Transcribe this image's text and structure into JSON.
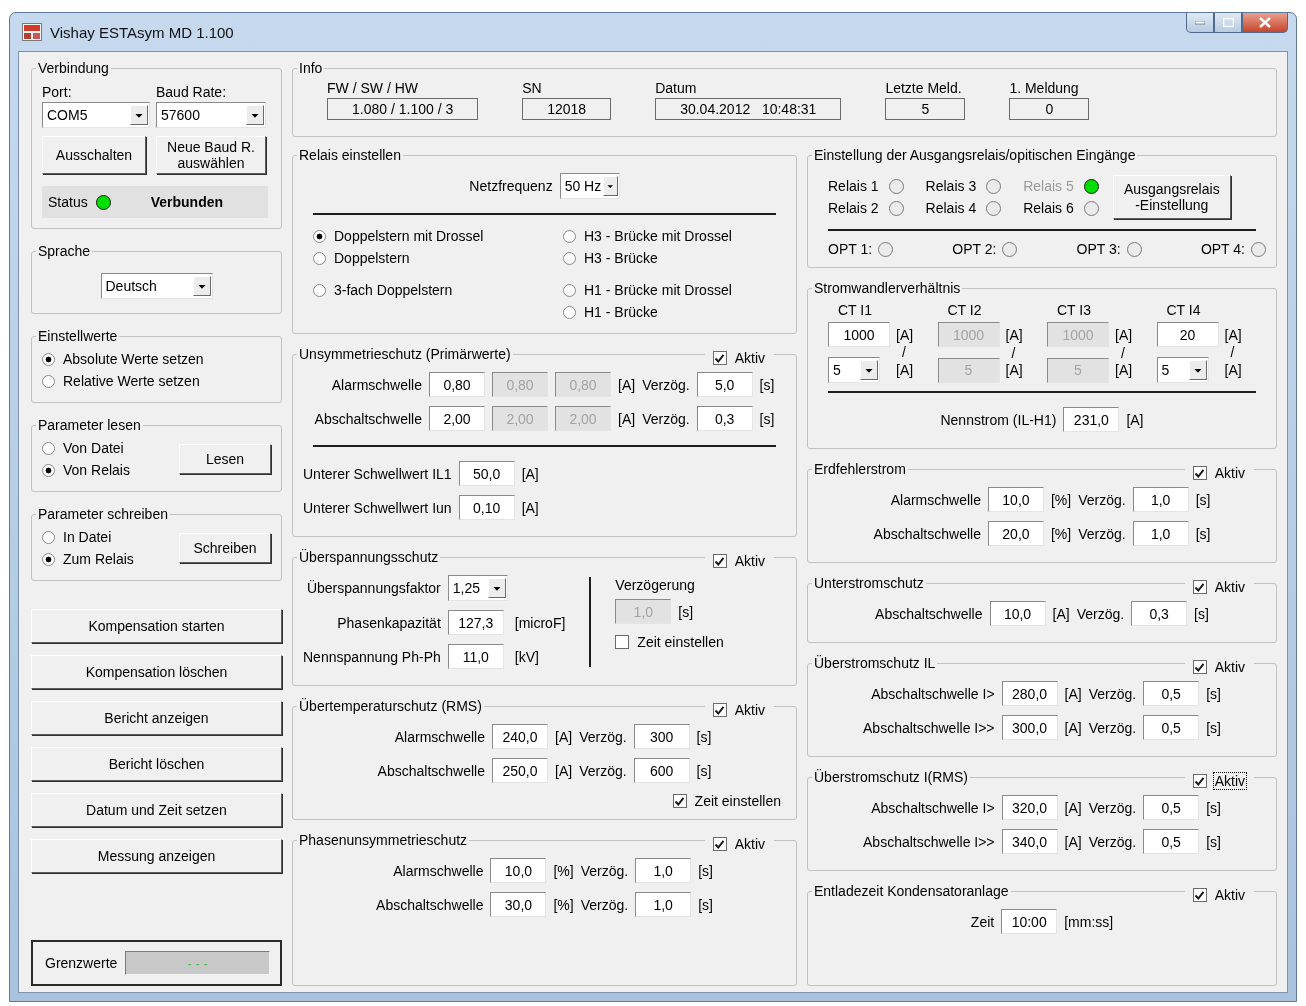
{
  "window": {
    "title": "Vishay ESTAsym MD 1.100"
  },
  "connection": {
    "title": "Verbindung",
    "port": {
      "label": "Port:",
      "value": "COM5"
    },
    "baud": {
      "label": "Baud Rate:",
      "value": "57600"
    },
    "buttons": [
      "Ausschalten",
      "Neue Baud R. auswählen"
    ],
    "status": {
      "label": "Status",
      "on": true,
      "text": "Verbunden"
    }
  },
  "language": {
    "title": "Sprache",
    "value": "Deutsch"
  },
  "radio_groups": [
    {
      "title": "Einstellwerte",
      "options": [
        {
          "label": "Absolute Werte setzen",
          "selected": true
        },
        {
          "label": "Relative Werte setzen",
          "selected": false
        }
      ]
    },
    {
      "title": "Parameter lesen",
      "options": [
        {
          "label": "Von Datei",
          "selected": false
        },
        {
          "label": "Von Relais",
          "selected": true
        }
      ],
      "button": "Lesen"
    },
    {
      "title": "Parameter schreiben",
      "options": [
        {
          "label": "In Datei",
          "selected": false
        },
        {
          "label": "Zum Relais",
          "selected": true
        }
      ],
      "button": "Schreiben"
    }
  ],
  "actions": [
    "Kompensation starten",
    "Kompensation löschen",
    "Bericht anzeigen",
    "Bericht löschen",
    "Datum und Zeit setzen",
    "Messung anzeigen"
  ],
  "limits": {
    "label": "Grenzwerte",
    "value": "- - -"
  },
  "info": {
    "title": "Info",
    "fields": [
      {
        "label": "FW / SW / HW",
        "value": "1.080 / 1.100 / 3"
      },
      {
        "label": "SN",
        "value": "12018"
      },
      {
        "label": "Datum",
        "value": "30.04.2012   10:48:31"
      },
      {
        "label": "Letzte Meld.",
        "value": "5"
      },
      {
        "label": "1. Meldung",
        "value": "0"
      }
    ]
  },
  "middle_groups": [
    {
      "title": "Relais einstellen",
      "blocks": [
        {
          "kind": "rows",
          "rows": [
            [
              {
                "kind": "label",
                "text": "Netzfrequenz"
              },
              {
                "kind": "combo",
                "value": "50 Hz"
              }
            ]
          ]
        },
        {
          "kind": "rule"
        },
        {
          "kind": "radios",
          "columns": [
            {
              "options": [
                {
                  "label": "Doppelstern mit Drossel",
                  "selected": true
                },
                {
                  "label": "Doppelstern",
                  "selected": false
                },
                {
                  "label": "3-fach Doppelstern",
                  "selected": false
                }
              ]
            },
            {
              "options": [
                {
                  "label": "H3 - Brücke mit Drossel",
                  "selected": false
                },
                {
                  "label": "H3 - Brücke",
                  "selected": false
                },
                {
                  "label": "H1 - Brücke mit Drossel",
                  "selected": false
                },
                {
                  "label": "H1 - Brücke",
                  "selected": false
                }
              ]
            }
          ]
        }
      ]
    },
    {
      "title": "Unsymmetrieschutz (Primärwerte)",
      "active": {
        "label": "Aktiv",
        "checked": true,
        "focused": false
      },
      "blocks": [
        {
          "kind": "rows",
          "rows": [
            [
              {
                "kind": "label",
                "text": "Alarmschwelle"
              },
              {
                "kind": "field",
                "value": "0,80",
                "disabled": false
              },
              {
                "kind": "field",
                "value": "0,80",
                "disabled": true
              },
              {
                "kind": "field",
                "value": "0,80",
                "disabled": true
              },
              {
                "kind": "unit",
                "text": "[A]"
              },
              {
                "kind": "label",
                "text": "Verzög."
              },
              {
                "kind": "field",
                "value": "5,0",
                "disabled": false
              },
              {
                "kind": "unit",
                "text": "[s]"
              }
            ],
            [
              {
                "kind": "label",
                "text": "Abschaltschwelle"
              },
              {
                "kind": "field",
                "value": "2,00",
                "disabled": false
              },
              {
                "kind": "field",
                "value": "2,00",
                "disabled": true
              },
              {
                "kind": "field",
                "value": "2,00",
                "disabled": true
              },
              {
                "kind": "unit",
                "text": "[A]"
              },
              {
                "kind": "label",
                "text": "Verzög."
              },
              {
                "kind": "field",
                "value": "0,3",
                "disabled": false
              },
              {
                "kind": "unit",
                "text": "[s]"
              }
            ]
          ]
        },
        {
          "kind": "rule"
        },
        {
          "kind": "rows_left",
          "rows": [
            [
              {
                "kind": "label",
                "text": "Unterer Schwellwert IL1"
              },
              {
                "kind": "field",
                "value": "50,0",
                "disabled": false
              },
              {
                "kind": "unit",
                "text": "[A]"
              }
            ],
            [
              {
                "kind": "label",
                "text": "Unterer Schwellwert Iun"
              },
              {
                "kind": "field",
                "value": "0,10",
                "disabled": false
              },
              {
                "kind": "unit",
                "text": "[A]"
              }
            ]
          ]
        }
      ]
    },
    {
      "title": "Überspannungsschutz",
      "active": {
        "label": "Aktiv",
        "checked": true,
        "focused": false
      },
      "blocks": [
        {
          "kind": "split",
          "left": [
            {
              "kind": "rows",
              "rows": [
                [
                  {
                    "kind": "label",
                    "text": "Überspannungsfaktor"
                  },
                  {
                    "kind": "combo",
                    "value": "1,25"
                  }
                ],
                [
                  {
                    "kind": "label",
                    "text": "Phasenkapazität"
                  },
                  {
                    "kind": "field",
                    "value": "127,3",
                    "disabled": false
                  },
                  {
                    "kind": "unit",
                    "text": "[microF]"
                  }
                ],
                [
                  {
                    "kind": "label",
                    "text": "Nennspannung Ph-Ph"
                  },
                  {
                    "kind": "field",
                    "value": "11,0",
                    "disabled": false
                  },
                  {
                    "kind": "unit",
                    "text": "[kV]"
                  }
                ]
              ]
            }
          ],
          "right": [
            {
              "kind": "caption",
              "text": "Verzögerung"
            },
            {
              "kind": "rows_left",
              "rows": [
                [
                  {
                    "kind": "field",
                    "value": "1,0",
                    "disabled": true
                  },
                  {
                    "kind": "unit",
                    "text": "[s]"
                  }
                ]
              ]
            },
            {
              "kind": "check",
              "label": "Zeit einstellen",
              "checked": false
            }
          ]
        }
      ]
    },
    {
      "title": "Übertemperaturschutz (RMS)",
      "active": {
        "label": "Aktiv",
        "checked": true,
        "focused": false
      },
      "blocks": [
        {
          "kind": "rows",
          "rows": [
            [
              {
                "kind": "label",
                "text": "Alarmschwelle"
              },
              {
                "kind": "field",
                "value": "240,0",
                "disabled": false
              },
              {
                "kind": "unit",
                "text": "[A]"
              },
              {
                "kind": "label",
                "text": "Verzög."
              },
              {
                "kind": "field",
                "value": "300",
                "disabled": false
              },
              {
                "kind": "unit",
                "text": "[s]"
              }
            ],
            [
              {
                "kind": "label",
                "text": "Abschaltschwelle"
              },
              {
                "kind": "field",
                "value": "250,0",
                "disabled": false
              },
              {
                "kind": "unit",
                "text": "[A]"
              },
              {
                "kind": "label",
                "text": "Verzög."
              },
              {
                "kind": "field",
                "value": "600",
                "disabled": false
              },
              {
                "kind": "unit",
                "text": "[s]"
              }
            ]
          ]
        },
        {
          "kind": "check",
          "label": "Zeit einstellen",
          "checked": true
        }
      ]
    },
    {
      "title": "Phasenunsymmetrieschutz",
      "active": {
        "label": "Aktiv",
        "checked": true,
        "focused": false
      },
      "blocks": [
        {
          "kind": "rows",
          "rows": [
            [
              {
                "kind": "label",
                "text": "Alarmschwelle"
              },
              {
                "kind": "field",
                "value": "10,0",
                "disabled": false
              },
              {
                "kind": "unit",
                "text": "[%]"
              },
              {
                "kind": "label",
                "text": "Verzög."
              },
              {
                "kind": "field",
                "value": "1,0",
                "disabled": false
              },
              {
                "kind": "unit",
                "text": "[s]"
              }
            ],
            [
              {
                "kind": "label",
                "text": "Abschaltschwelle"
              },
              {
                "kind": "field",
                "value": "30,0",
                "disabled": false
              },
              {
                "kind": "unit",
                "text": "[%]"
              },
              {
                "kind": "label",
                "text": "Verzög."
              },
              {
                "kind": "field",
                "value": "1,0",
                "disabled": false
              },
              {
                "kind": "unit",
                "text": "[s]"
              }
            ]
          ]
        }
      ]
    }
  ],
  "right_groups": [
    {
      "title": "Einstellung der Ausgangsrelais/opitischen Eingänge",
      "blocks": [
        {
          "kind": "relays",
          "items": [
            {
              "label": "Relais 1",
              "on": false,
              "disabled": false
            },
            {
              "label": "Relais 2",
              "on": false,
              "disabled": false
            },
            {
              "label": "Relais 3",
              "on": false,
              "disabled": false
            },
            {
              "label": "Relais 4",
              "on": false,
              "disabled": false
            },
            {
              "label": "Relais 5",
              "on": true,
              "disabled": true
            },
            {
              "label": "Relais 6",
              "on": false,
              "disabled": false
            }
          ],
          "button": "Ausgangsrelais -Einstellung"
        },
        {
          "kind": "rule"
        },
        {
          "kind": "opts",
          "items": [
            {
              "label": "OPT 1:",
              "on": false
            },
            {
              "label": "OPT 2:",
              "on": false
            },
            {
              "label": "OPT 3:",
              "on": false
            },
            {
              "label": "OPT 4:",
              "on": false
            }
          ]
        }
      ]
    },
    {
      "title": "Stromwandlerverhältnis",
      "blocks": [
        {
          "kind": "ct",
          "columns": [
            {
              "label": "CT I1",
              "primary": {
                "value": "1000",
                "disabled": false
              },
              "primary_unit": "[A]",
              "divider": "/",
              "secondary": {
                "kind": "combo",
                "value": "5"
              },
              "secondary_unit": "[A]"
            },
            {
              "label": "CT I2",
              "primary": {
                "value": "1000",
                "disabled": true
              },
              "primary_unit": "[A]",
              "divider": "/",
              "secondary": {
                "kind": "field",
                "value": "5",
                "disabled": true
              },
              "secondary_unit": "[A]"
            },
            {
              "label": "CT I3",
              "primary": {
                "value": "1000",
                "disabled": true
              },
              "primary_unit": "[A]",
              "divider": "/",
              "secondary": {
                "kind": "field",
                "value": "5",
                "disabled": true
              },
              "secondary_unit": "[A]"
            },
            {
              "label": "CT I4",
              "primary": {
                "value": "20",
                "disabled": false
              },
              "primary_unit": "[A]",
              "divider": "/",
              "secondary": {
                "kind": "combo",
                "value": "5"
              },
              "secondary_unit": "[A]"
            }
          ]
        },
        {
          "kind": "rule"
        },
        {
          "kind": "rows",
          "rows": [
            [
              {
                "kind": "label",
                "text": "Nennstrom (IL-H1)"
              },
              {
                "kind": "field",
                "value": "231,0",
                "disabled": false
              },
              {
                "kind": "unit",
                "text": "[A]"
              }
            ]
          ]
        }
      ]
    },
    {
      "title": "Erdfehlerstrom",
      "active": {
        "label": "Aktiv",
        "checked": true,
        "focused": false
      },
      "blocks": [
        {
          "kind": "rows",
          "rows": [
            [
              {
                "kind": "label",
                "text": "Alarmschwelle"
              },
              {
                "kind": "field",
                "value": "10,0",
                "disabled": false
              },
              {
                "kind": "unit",
                "text": "[%]"
              },
              {
                "kind": "label",
                "text": "Verzög."
              },
              {
                "kind": "field",
                "value": "1,0",
                "disabled": false
              },
              {
                "kind": "unit",
                "text": "[s]"
              }
            ],
            [
              {
                "kind": "label",
                "text": "Abschaltschwelle"
              },
              {
                "kind": "field",
                "value": "20,0",
                "disabled": false
              },
              {
                "kind": "unit",
                "text": "[%]"
              },
              {
                "kind": "label",
                "text": "Verzög."
              },
              {
                "kind": "field",
                "value": "1,0",
                "disabled": false
              },
              {
                "kind": "unit",
                "text": "[s]"
              }
            ]
          ]
        }
      ]
    },
    {
      "title": "Unterstromschutz",
      "active": {
        "label": "Aktiv",
        "checked": true,
        "focused": false
      },
      "blocks": [
        {
          "kind": "rows",
          "rows": [
            [
              {
                "kind": "label",
                "text": "Abschaltschwelle"
              },
              {
                "kind": "field",
                "value": "10,0",
                "disabled": false
              },
              {
                "kind": "unit",
                "text": "[A]"
              },
              {
                "kind": "label",
                "text": "Verzög."
              },
              {
                "kind": "field",
                "value": "0,3",
                "disabled": false
              },
              {
                "kind": "unit",
                "text": "[s]"
              }
            ]
          ]
        }
      ]
    },
    {
      "title": "Überstromschutz IL",
      "active": {
        "label": "Aktiv",
        "checked": true,
        "focused": false
      },
      "blocks": [
        {
          "kind": "rows",
          "rows": [
            [
              {
                "kind": "label",
                "text": "Abschaltschwelle I>"
              },
              {
                "kind": "field",
                "value": "280,0",
                "disabled": false
              },
              {
                "kind": "unit",
                "text": "[A]"
              },
              {
                "kind": "label",
                "text": "Verzög."
              },
              {
                "kind": "field",
                "value": "0,5",
                "disabled": false
              },
              {
                "kind": "unit",
                "text": "[s]"
              }
            ],
            [
              {
                "kind": "label",
                "text": "Abschaltschwelle I>>"
              },
              {
                "kind": "field",
                "value": "300,0",
                "disabled": false
              },
              {
                "kind": "unit",
                "text": "[A]"
              },
              {
                "kind": "label",
                "text": "Verzög."
              },
              {
                "kind": "field",
                "value": "0,5",
                "disabled": false
              },
              {
                "kind": "unit",
                "text": "[s]"
              }
            ]
          ]
        }
      ]
    },
    {
      "title": "Überstromschutz I(RMS)",
      "active": {
        "label": "Aktiv",
        "checked": true,
        "focused": true
      },
      "blocks": [
        {
          "kind": "rows",
          "rows": [
            [
              {
                "kind": "label",
                "text": "Abschaltschwelle I>"
              },
              {
                "kind": "field",
                "value": "320,0",
                "disabled": false
              },
              {
                "kind": "unit",
                "text": "[A]"
              },
              {
                "kind": "label",
                "text": "Verzög."
              },
              {
                "kind": "field",
                "value": "0,5",
                "disabled": false
              },
              {
                "kind": "unit",
                "text": "[s]"
              }
            ],
            [
              {
                "kind": "label",
                "text": "Abschaltschwelle I>>"
              },
              {
                "kind": "field",
                "value": "340,0",
                "disabled": false
              },
              {
                "kind": "unit",
                "text": "[A]"
              },
              {
                "kind": "label",
                "text": "Verzög."
              },
              {
                "kind": "field",
                "value": "0,5",
                "disabled": false
              },
              {
                "kind": "unit",
                "text": "[s]"
              }
            ]
          ]
        }
      ]
    },
    {
      "title": "Entladezeit Kondensatoranlage",
      "active": {
        "label": "Aktiv",
        "checked": true,
        "focused": false
      },
      "blocks": [
        {
          "kind": "rows",
          "rows": [
            [
              {
                "kind": "label",
                "text": "Zeit"
              },
              {
                "kind": "field",
                "value": "10:00",
                "disabled": false
              },
              {
                "kind": "unit",
                "text": "[mm:ss]"
              }
            ]
          ]
        }
      ]
    }
  ]
}
